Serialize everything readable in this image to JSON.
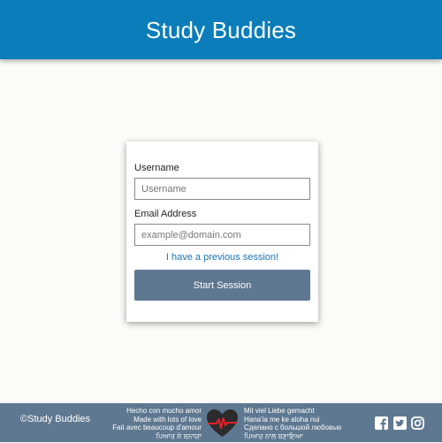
{
  "header": {
    "title": "Study Buddies"
  },
  "form": {
    "username_label": "Username",
    "username_placeholder": "Username",
    "email_label": "Email Address",
    "email_placeholder": "example@domain.com",
    "previous_session_link": "I have a previous session!",
    "start_button": "Start Session"
  },
  "footer": {
    "copyright": "©Study Buddies",
    "love_left": [
      "Hecho con mucho amor",
      "Made with lots of love",
      "Fait avec beaucoup d'amour",
      "ਪਿਆਰ ਸੇ ਬਨਾਯਾ"
    ],
    "love_right": [
      "Mit viel Liebe gemacht",
      "Hana'ia me ke aloha nui",
      "Сделано с большой любовью",
      "ਪਿਆਰ ਨਾਲ ਬਣਾਇਆ"
    ],
    "icons": [
      "heart-pulse-icon",
      "facebook-icon",
      "twitter-icon",
      "instagram-icon"
    ]
  },
  "colors": {
    "header_bg": "#0a7dba",
    "footer_bg": "#5f7891",
    "button_bg": "#5f7891",
    "link": "#1a73b7",
    "page_bg": "#fbfcf8",
    "heart": "#2b2b2b",
    "pulse": "#e8202a"
  }
}
